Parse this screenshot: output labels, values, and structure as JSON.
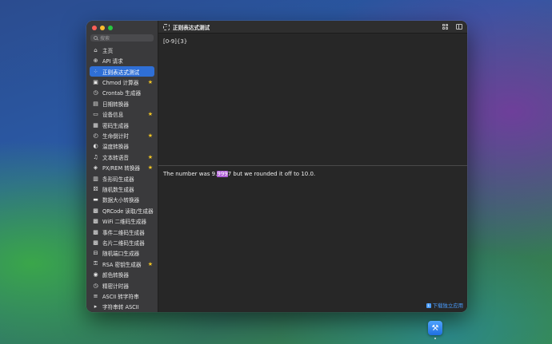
{
  "window": {
    "title": "正则表达式测试"
  },
  "sidebar": {
    "search_placeholder": "搜索",
    "items": [
      {
        "label": "主页",
        "icon": "⌂",
        "star": false,
        "active": false
      },
      {
        "label": "API 请求",
        "icon": "⊕",
        "star": false,
        "active": false
      },
      {
        "label": "正则表达式测试",
        "icon": "⁘",
        "star": false,
        "active": true
      },
      {
        "label": "Chmod 计算器",
        "icon": "▣",
        "star": true,
        "active": false
      },
      {
        "label": "Crontab 生成器",
        "icon": "◷",
        "star": false,
        "active": false
      },
      {
        "label": "日期转换器",
        "icon": "▤",
        "star": false,
        "active": false
      },
      {
        "label": "设备信息",
        "icon": "▭",
        "star": true,
        "active": false
      },
      {
        "label": "密码生成器",
        "icon": "▦",
        "star": false,
        "active": false
      },
      {
        "label": "生命倒计时",
        "icon": "◴",
        "star": true,
        "active": false
      },
      {
        "label": "温度转换器",
        "icon": "◐",
        "star": false,
        "active": false
      },
      {
        "label": "文本转语音",
        "icon": "♫",
        "star": true,
        "active": false
      },
      {
        "label": "PX/REM 转换器",
        "icon": "◈",
        "star": true,
        "active": false
      },
      {
        "label": "条形码生成器",
        "icon": "▥",
        "star": false,
        "active": false
      },
      {
        "label": "随机数生成器",
        "icon": "⚄",
        "star": false,
        "active": false
      },
      {
        "label": "数据大小转换器",
        "icon": "▬",
        "star": false,
        "active": false
      },
      {
        "label": "QRCode 读取/生成器",
        "icon": "▩",
        "star": false,
        "active": false
      },
      {
        "label": "WiFi 二维码生成器",
        "icon": "▩",
        "star": false,
        "active": false
      },
      {
        "label": "事件二维码生成器",
        "icon": "▩",
        "star": false,
        "active": false
      },
      {
        "label": "名片二维码生成器",
        "icon": "▩",
        "star": false,
        "active": false
      },
      {
        "label": "随机端口生成器",
        "icon": "⊟",
        "star": false,
        "active": false
      },
      {
        "label": "RSA 密钥生成器",
        "icon": "⚿",
        "star": true,
        "active": false
      },
      {
        "label": "颜色转换器",
        "icon": "◉",
        "star": false,
        "active": false
      },
      {
        "label": "精密计时器",
        "icon": "◷",
        "star": false,
        "active": false
      },
      {
        "label": "ASCII 转字符串",
        "icon": "≡",
        "star": false,
        "active": false
      },
      {
        "label": "字符串转 ASCII",
        "icon": "▸",
        "star": false,
        "active": false
      }
    ]
  },
  "editor": {
    "pattern": "[0-9]{3}"
  },
  "result": {
    "before": "The number was 9.",
    "match": "999",
    "after": "7 but we rounded it off to 10.0."
  },
  "footer": {
    "download_label": "下载独立应用"
  },
  "colors": {
    "accent": "#2f6fd6",
    "highlight": "#b05fd8",
    "star": "#f3c623",
    "link": "#4a9dff"
  }
}
